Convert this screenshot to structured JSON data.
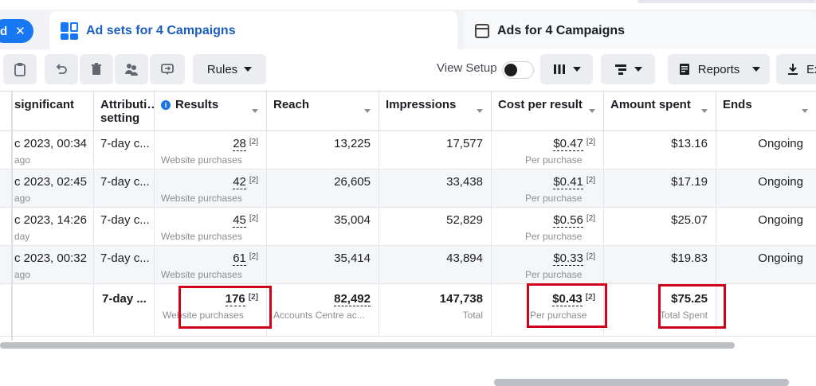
{
  "tabs": {
    "pill_label": "d",
    "active": "Ad sets for 4 Campaigns",
    "inactive": "Ads for 4 Campaigns"
  },
  "toolbar": {
    "rules_label": "Rules",
    "view_setup_label": "View Setup",
    "reports_label": "Reports",
    "export_label": "Ex"
  },
  "columns": {
    "significant": "significant",
    "attribution": "Attributi… setting",
    "results": "Results",
    "reach": "Reach",
    "impressions": "Impressions",
    "cost_per_result": "Cost per result",
    "amount_spent": "Amount spent",
    "ends": "Ends"
  },
  "rows": [
    {
      "date": "c 2023, 00:34",
      "date_sub": "ago",
      "attribution": "7-day c...",
      "results": "28",
      "results_sub": "Website purchases",
      "reach": "13,225",
      "impressions": "17,577",
      "cpr": "$0.47",
      "cpr_sub": "Per purchase",
      "spent": "$13.16",
      "ends": "Ongoing"
    },
    {
      "date": "c 2023, 02:45",
      "date_sub": "ago",
      "attribution": "7-day c...",
      "results": "42",
      "results_sub": "Website purchases",
      "reach": "26,605",
      "impressions": "33,438",
      "cpr": "$0.41",
      "cpr_sub": "Per purchase",
      "spent": "$17.19",
      "ends": "Ongoing"
    },
    {
      "date": "c 2023, 14:26",
      "date_sub": "day",
      "attribution": "7-day c...",
      "results": "45",
      "results_sub": "Website purchases",
      "reach": "35,004",
      "impressions": "52,829",
      "cpr": "$0.56",
      "cpr_sub": "Per purchase",
      "spent": "$25.07",
      "ends": "Ongoing"
    },
    {
      "date": "c 2023, 00:32",
      "date_sub": "ago",
      "attribution": "7-day c...",
      "results": "61",
      "results_sub": "Website purchases",
      "reach": "35,414",
      "impressions": "43,894",
      "cpr": "$0.33",
      "cpr_sub": "Per purchase",
      "spent": "$19.83",
      "ends": "Ongoing"
    }
  ],
  "total": {
    "attribution": "7-day ...",
    "results": "176",
    "results_sub": "Website purchases",
    "reach": "82,492",
    "reach_sub": "Accounts Centre ac...",
    "impressions": "147,738",
    "impressions_sub": "Total",
    "cpr": "$0.43",
    "cpr_sub": "Per purchase",
    "spent": "$75.25",
    "spent_sub": "Total Spent"
  },
  "sup_marker": "[2]",
  "colors": {
    "accent": "#1877f2",
    "highlight": "#d0021b"
  }
}
